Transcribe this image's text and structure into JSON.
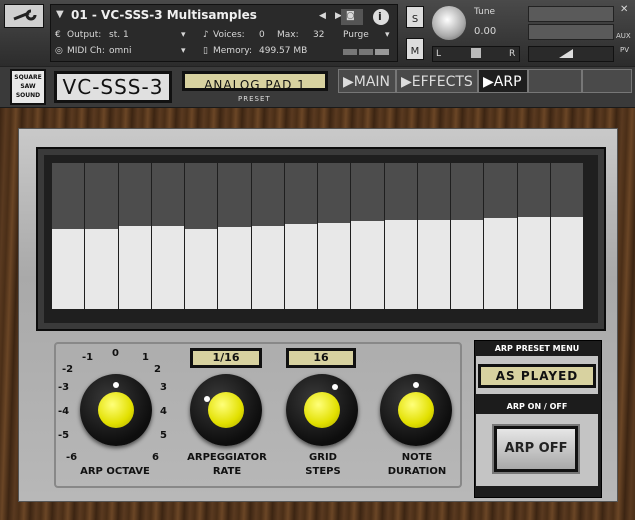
{
  "header": {
    "instrument_name": "01 - VC-SSS-3 Multisamples",
    "output_label": "Output:",
    "output_value": "st. 1",
    "midi_label": "MIDI Ch:",
    "midi_value": "omni",
    "voices_label": "Voices:",
    "voices_value": "0",
    "max_label": "Max:",
    "max_value": "32",
    "memory_label": "Memory:",
    "memory_value": "499.57 MB",
    "purge_label": "Purge",
    "solo_label": "S",
    "mute_label": "M",
    "tune_label": "Tune",
    "tune_value": "0.00",
    "pan_left": "L",
    "pan_right": "R",
    "aux_label": "AUX",
    "pv_label": "PV",
    "info_label": "i"
  },
  "instrument": {
    "logo_lines": [
      "SQUARE",
      "SAW",
      "SOUND"
    ],
    "product_name": "VC-SSS-3",
    "preset_value": "ANALOG PAD 1",
    "preset_caption": "PRESET",
    "tabs": [
      {
        "label": "▶MAIN",
        "active": false
      },
      {
        "label": "▶EFFECTS",
        "active": false
      },
      {
        "label": "▶ARP",
        "active": true
      }
    ]
  },
  "arp": {
    "steps": [
      0.55,
      0.55,
      0.57,
      0.57,
      0.55,
      0.56,
      0.57,
      0.58,
      0.59,
      0.6,
      0.61,
      0.61,
      0.61,
      0.62,
      0.63,
      0.63
    ],
    "octave_ticks": [
      "-1",
      "0",
      "1",
      "-2",
      "2",
      "-3",
      "3",
      "-4",
      "4",
      "-5",
      "5",
      "-6",
      "6"
    ],
    "octave_label": "ARP OCTAVE",
    "rate_value": "1/16",
    "rate_label_1": "ARPEGGIATOR",
    "rate_label_2": "RATE",
    "grid_value": "16",
    "grid_label_1": "GRID",
    "grid_label_2": "STEPS",
    "note_label_1": "NOTE",
    "note_label_2": "DURATION",
    "preset_menu_label": "ARP PRESET MENU",
    "preset_menu_value": "AS PLAYED",
    "on_off_label": "ARP ON / OFF",
    "on_off_button": "ARP OFF"
  }
}
